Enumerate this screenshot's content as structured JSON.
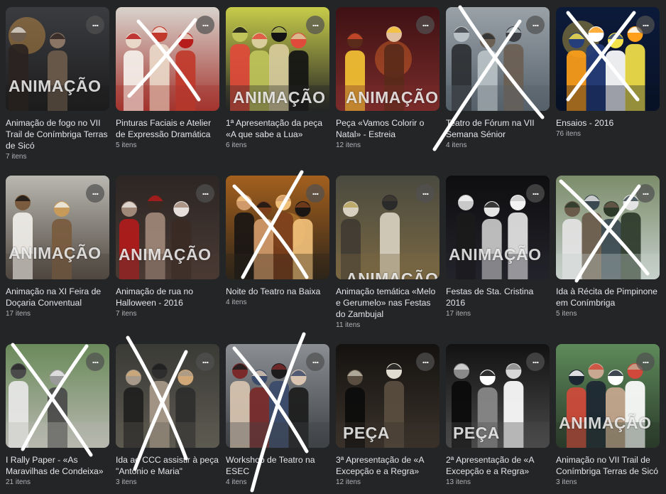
{
  "albums": [
    {
      "title": "Animação de fogo no VII Trail de Conímbriga Terras de Sicó",
      "count": "7 itens",
      "overlay": "ANIMAÇÃO",
      "more_icon": "more-dots-icon"
    },
    {
      "title": "Pinturas Faciais e Atelier de Expressão Dramática",
      "count": "5 itens",
      "overlay": "",
      "more_icon": "more-dots-icon"
    },
    {
      "title": "1ª Apresentação da peça «A que sabe a Lua»",
      "count": "6 itens",
      "overlay": "ANIMAÇÃO",
      "more_icon": "more-dots-icon"
    },
    {
      "title": "Peça «Vamos Colorir o Natal» - Estreia",
      "count": "12 itens",
      "overlay": "ANIMAÇÃO",
      "more_icon": "more-dots-icon"
    },
    {
      "title": "Teatro de Fórum na VII Semana Sénior",
      "count": "4 itens",
      "overlay": "",
      "more_icon": "more-dots-icon"
    },
    {
      "title": "Ensaios - 2016",
      "count": "76 itens",
      "overlay": "",
      "more_icon": "more-dots-icon"
    },
    {
      "title": "Animação na XI Feira de Doçaria Conventual",
      "count": "17 itens",
      "overlay": "ANIMAÇÃO",
      "more_icon": "more-dots-icon"
    },
    {
      "title": "Animação de rua no Halloween - 2016",
      "count": "7 itens",
      "overlay": "ANIMAÇÃO",
      "more_icon": "more-dots-icon"
    },
    {
      "title": "Noite do Teatro na Baixa",
      "count": "4 itens",
      "overlay": "",
      "more_icon": "more-dots-icon"
    },
    {
      "title": "Animação temática «Melo e Gerumelo» nas Festas do Zambujal",
      "count": "11 itens",
      "overlay": "ANIMAÇÃO",
      "more_icon": "more-dots-icon"
    },
    {
      "title": "Festas de Sta. Cristina 2016",
      "count": "17 itens",
      "overlay": "ANIMAÇÃO",
      "more_icon": "more-dots-icon"
    },
    {
      "title": "Ida à Récita de Pimpinone em Conímbriga",
      "count": "5 itens",
      "overlay": "",
      "more_icon": "more-dots-icon"
    },
    {
      "title": "I Rally Paper - «As Maravilhas de Condeixa»",
      "count": "21 itens",
      "overlay": "",
      "more_icon": "more-dots-icon"
    },
    {
      "title": "Ida ao CCC assistir à peça \"António e Maria\"",
      "count": "3 itens",
      "overlay": "",
      "more_icon": "more-dots-icon"
    },
    {
      "title": "Workshop de Teatro na ESEC",
      "count": "4 itens",
      "overlay": "",
      "more_icon": "more-dots-icon"
    },
    {
      "title": "3ª Apresentação de «A Excepção e a Regra»",
      "count": "12 itens",
      "overlay": "PEÇA",
      "more_icon": "more-dots-icon"
    },
    {
      "title": "2ª Apresentação de «A Excepção e a Regra»",
      "count": "13 itens",
      "overlay": "PEÇA",
      "more_icon": "more-dots-icon"
    },
    {
      "title": "Animação no VII Trail de Conímbriga Terras de Sicó",
      "count": "3 itens",
      "overlay": "ANIMAÇÃO",
      "more_icon": "more-dots-icon"
    }
  ],
  "more_glyph": "...",
  "colors": {
    "background": "#242526",
    "title_text": "#e4e6eb",
    "count_text": "#b0b3b8",
    "scribble": "#ffffff"
  }
}
